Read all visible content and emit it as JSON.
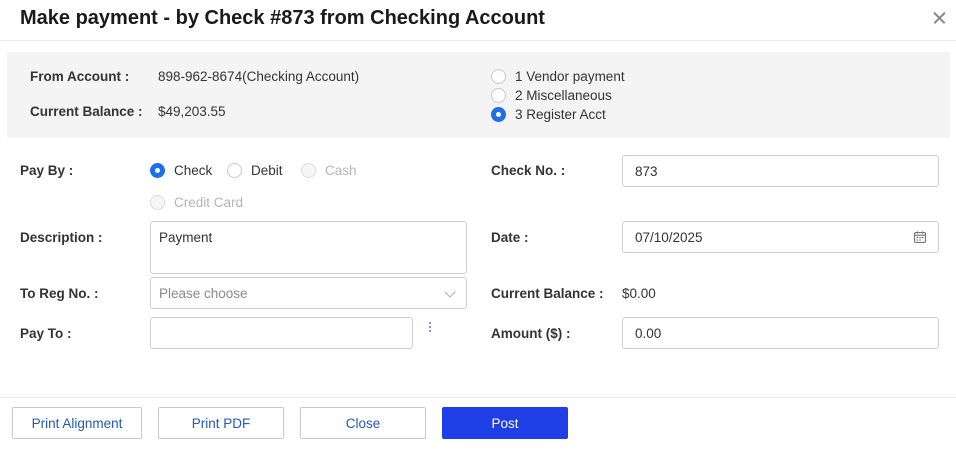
{
  "dialog": {
    "title": "Make payment - by Check #873 from Checking Account"
  },
  "account_info": {
    "from_account_label": "From Account",
    "from_account_value": "898-962-8674(Checking Account)",
    "current_balance_label": "Current Balance",
    "current_balance_value": "$49,203.55"
  },
  "payment_type": {
    "options": [
      {
        "label": "1 Vendor payment",
        "checked": false
      },
      {
        "label": "2 Miscellaneous",
        "checked": false
      },
      {
        "label": "3 Register Acct",
        "checked": true
      }
    ]
  },
  "form": {
    "pay_by_label": "Pay By",
    "pay_by_options": [
      {
        "label": "Check",
        "checked": true,
        "disabled": false
      },
      {
        "label": "Debit",
        "checked": false,
        "disabled": false
      },
      {
        "label": "Cash",
        "checked": false,
        "disabled": true
      },
      {
        "label": "Credit Card",
        "checked": false,
        "disabled": true
      }
    ],
    "description_label": "Description",
    "description_value": "Payment",
    "to_reg_no_label": "To Reg No.",
    "to_reg_no_placeholder": "Please choose",
    "pay_to_label": "Pay To",
    "pay_to_value": "",
    "check_no_label": "Check No.",
    "check_no_value": "873",
    "date_label": "Date",
    "date_value": "07/10/2025",
    "current_balance_label": "Current Balance",
    "current_balance_value": "$0.00",
    "amount_label": "Amount ($)",
    "amount_value": "0.00"
  },
  "footer": {
    "print_alignment": "Print Alignment",
    "print_pdf": "Print PDF",
    "close": "Close",
    "post": "Post"
  },
  "colors": {
    "accent": "#1f6feb",
    "primary_button": "#1e3ee6",
    "link_text": "#2458b8"
  }
}
